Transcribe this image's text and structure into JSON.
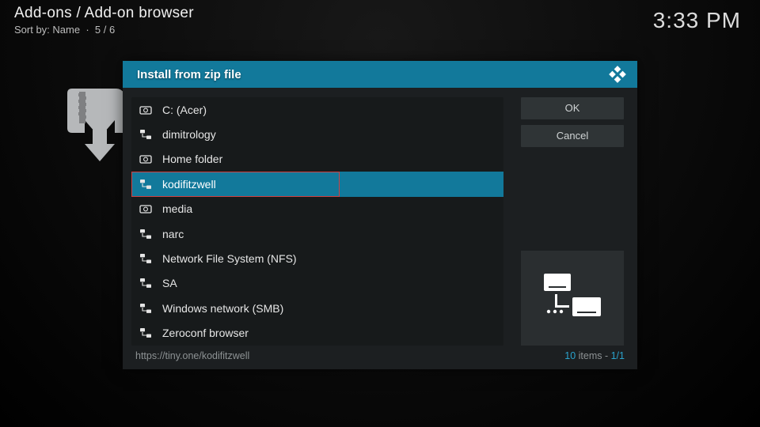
{
  "header": {
    "breadcrumb": "Add-ons / Add-on browser",
    "sort_prefix": "Sort by: ",
    "sort_value": "Name",
    "count": "5 / 6",
    "clock": "3:33 PM"
  },
  "dialog": {
    "title": "Install from zip file",
    "buttons": {
      "ok": "OK",
      "cancel": "Cancel"
    },
    "items": [
      {
        "icon": "drive",
        "label": "C: (Acer)",
        "selected": false
      },
      {
        "icon": "net",
        "label": "dimitrology",
        "selected": false
      },
      {
        "icon": "drive",
        "label": "Home folder",
        "selected": false
      },
      {
        "icon": "net",
        "label": "kodifitzwell",
        "selected": true
      },
      {
        "icon": "drive",
        "label": "media",
        "selected": false
      },
      {
        "icon": "net",
        "label": "narc",
        "selected": false
      },
      {
        "icon": "net",
        "label": "Network File System (NFS)",
        "selected": false
      },
      {
        "icon": "net",
        "label": "SA",
        "selected": false
      },
      {
        "icon": "net",
        "label": "Windows network (SMB)",
        "selected": false
      },
      {
        "icon": "net",
        "label": "Zeroconf browser",
        "selected": false
      }
    ],
    "footer": {
      "path": "https://tiny.one/kodifitzwell",
      "count_n": "10",
      "count_txt": " items - ",
      "page": "1/1"
    }
  }
}
